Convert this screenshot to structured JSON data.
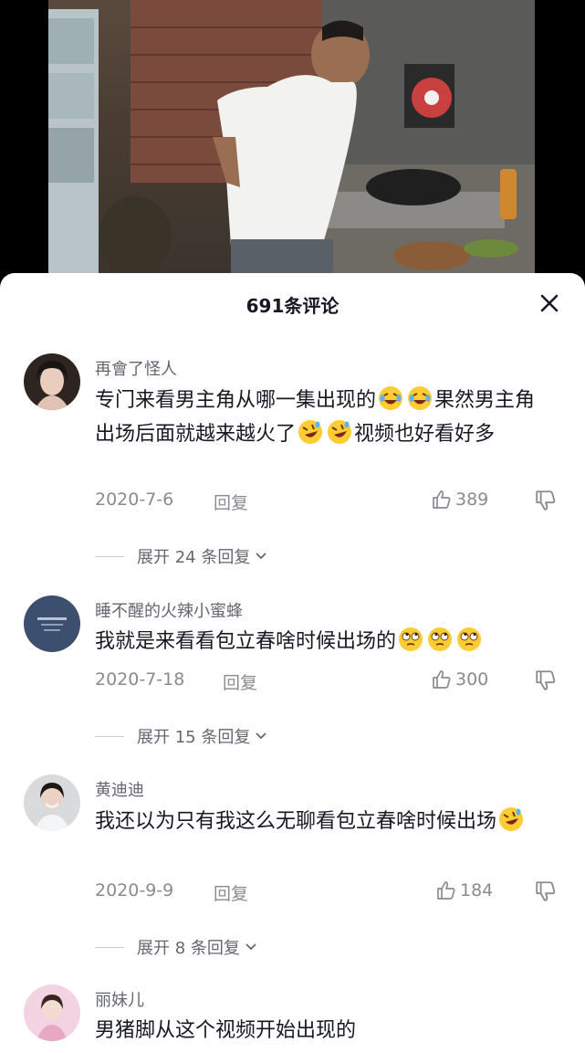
{
  "sheet": {
    "title": "691条评论",
    "close_icon": "close-icon"
  },
  "comments": [
    {
      "user": "再會了怪人",
      "text_parts": [
        "专门来看男主角从哪一集出现的",
        "果然男主角出场后面就越来越火了",
        "视频也好看好多"
      ],
      "emojis": [
        "laugh-cry-emoji",
        "laugh-cry-emoji",
        "rolling-laugh-emoji",
        "rolling-laugh-emoji"
      ],
      "date": "2020-7-6",
      "reply_label": "回复",
      "likes": "389",
      "expand_label": "展开 24 条回复"
    },
    {
      "user": "睡不醒的火辣小蜜蜂",
      "text_parts": [
        "我就是来看看包立春啥时候出场的"
      ],
      "emojis": [
        "eye-roll-emoji",
        "eye-roll-emoji",
        "eye-roll-emoji"
      ],
      "date": "2020-7-18",
      "reply_label": "回复",
      "likes": "300",
      "expand_label": "展开 15 条回复"
    },
    {
      "user": "黄迪迪",
      "text_parts": [
        "我还以为只有我这么无聊看包立春啥时候出场"
      ],
      "emojis": [
        "rolling-laugh-emoji"
      ],
      "date": "2020-9-9",
      "reply_label": "回复",
      "likes": "184",
      "expand_label": "展开 8 条回复"
    },
    {
      "user": "丽妹儿",
      "text_parts": [
        "男猪脚从这个视频开始出现的"
      ]
    }
  ]
}
